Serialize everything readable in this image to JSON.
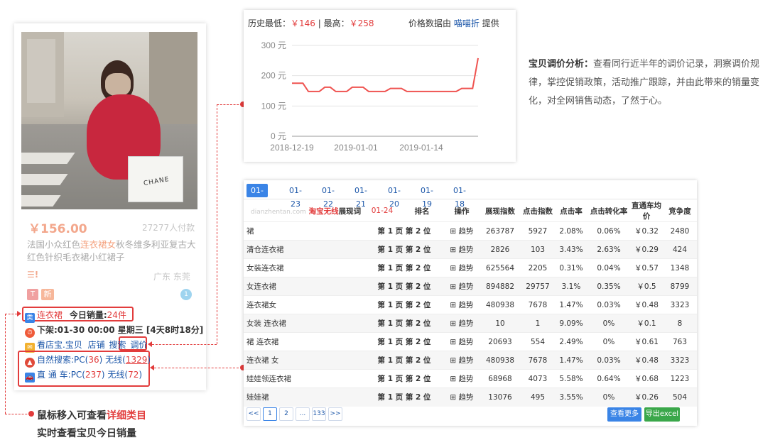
{
  "product": {
    "price": "￥156.00",
    "paid": "27277人付款",
    "title_pre": "法国小众红色",
    "title_hl": "连衣裙女",
    "title_post": "秋冬维多利亚复古大红色针织毛衣裙小红裙子",
    "location": "广东 东莞",
    "menu_icon": "☰!",
    "badge_tmall": "T",
    "badge_new": "新",
    "badge_round": "1",
    "bag_text": "CHANE"
  },
  "info": {
    "category": "连衣裙",
    "today_sales_label": "今日销量:",
    "today_sales_value": "24件",
    "off_shelf": "下架:01-30 00:00 星期三 [4天8时18分]",
    "links": [
      "看店宝.宝贝",
      "店铺",
      "搜索",
      "调价"
    ],
    "natural_search_label": "自然搜索:",
    "natural_pc_label": "PC(",
    "natural_pc": "36",
    "natural_wireless_label": ") 无线(",
    "natural_wireless": "1329",
    "through_train_label": "直 通 车:",
    "tt_pc_label": "PC(",
    "tt_pc": "237",
    "tt_wireless_label": ") 无线(",
    "tt_wireless": "72",
    "close_paren": ")"
  },
  "price_chart": {
    "low_label": "历史最低：",
    "low_value": "￥146",
    "sep": " | ",
    "high_label": "最高：",
    "high_value": "￥258",
    "source_pre": "价格数据由 ",
    "source_brand": "喵喵折",
    "source_post": " 提供"
  },
  "chart_data": {
    "type": "line",
    "yticks": [
      "300 元",
      "200 元",
      "100 元",
      "0 元"
    ],
    "ylim": [
      0,
      300
    ],
    "xticks": [
      "2018-12-19",
      "2019-01-01",
      "2019-01-14"
    ],
    "series": [
      {
        "values": [
          175,
          175,
          175,
          148,
          148,
          148,
          162,
          162,
          148,
          148,
          148,
          162,
          162,
          162,
          148,
          148,
          148,
          148,
          158,
          158,
          158,
          148,
          148,
          148,
          148,
          148,
          148,
          148,
          148,
          148,
          148,
          158,
          158,
          158,
          258
        ]
      }
    ],
    "color": "#ef5350"
  },
  "description": {
    "bold": "宝贝调价分析：",
    "text": "查看同行近半年的调价记录，洞察调价规律，掌控促销政策，活动推广跟踪，并由此带来的销量变化，对全网销售动态，了然于心。"
  },
  "keyword_table": {
    "date_tabs": [
      "01-24",
      "01-23",
      "01-22",
      "01-21",
      "01-20",
      "01-19",
      "01-18"
    ],
    "watermark": "dianzhentan.com",
    "kw_header_red": "淘宝无线",
    "kw_header": "展现词",
    "headers": [
      "01-24",
      "排名",
      "操作",
      "展现指数",
      "点击指数",
      "点击率",
      "点击转化率",
      "直通车均价",
      "竞争度"
    ],
    "trend_label": "⊞ 趋势",
    "rows": [
      [
        "裙",
        "第 1 页 第 2 位",
        "263787",
        "5927",
        "2.08%",
        "0.06%",
        "￥0.32",
        "2480"
      ],
      [
        "清仓连衣裙",
        "第 1 页 第 2 位",
        "2826",
        "103",
        "3.43%",
        "2.63%",
        "￥0.29",
        "424"
      ],
      [
        "女装连衣裙",
        "第 1 页 第 2 位",
        "625564",
        "2205",
        "0.31%",
        "0.04%",
        "￥0.57",
        "1348"
      ],
      [
        "女连衣裙",
        "第 1 页 第 2 位",
        "894882",
        "29757",
        "3.1%",
        "0.35%",
        "￥0.5",
        "8799"
      ],
      [
        "连衣裙女",
        "第 1 页 第 2 位",
        "480938",
        "7678",
        "1.47%",
        "0.03%",
        "￥0.48",
        "3323"
      ],
      [
        "女装 连衣裙",
        "第 1 页 第 2 位",
        "10",
        "1",
        "9.09%",
        "0%",
        "￥0.1",
        "8"
      ],
      [
        "裙 连衣裙",
        "第 1 页 第 2 位",
        "20693",
        "554",
        "2.49%",
        "0%",
        "￥0.61",
        "763"
      ],
      [
        "连衣裙 女",
        "第 1 页 第 2 位",
        "480938",
        "7678",
        "1.47%",
        "0.03%",
        "￥0.48",
        "3323"
      ],
      [
        "娃娃领连衣裙",
        "第 1 页 第 2 位",
        "68968",
        "4073",
        "5.58%",
        "0.64%",
        "￥0.68",
        "1223"
      ],
      [
        "娃娃裙",
        "第 1 页 第 2 位",
        "13076",
        "495",
        "3.55%",
        "0%",
        "￥0.26",
        "504"
      ]
    ],
    "pagination": [
      "<<",
      "1",
      "2",
      "...",
      "133",
      ">>"
    ],
    "more_button": "查看更多",
    "export_button": "导出excel"
  },
  "notes": {
    "line1_pre": "鼠标移入可查看",
    "line1_hl": "详细类目",
    "line2": "实时查看宝贝今日销量"
  },
  "colors": {
    "accent_red": "#e23c3c",
    "link_blue": "#1a55a8",
    "tab_blue": "#3a84e6",
    "export_green": "#3aa74a"
  }
}
